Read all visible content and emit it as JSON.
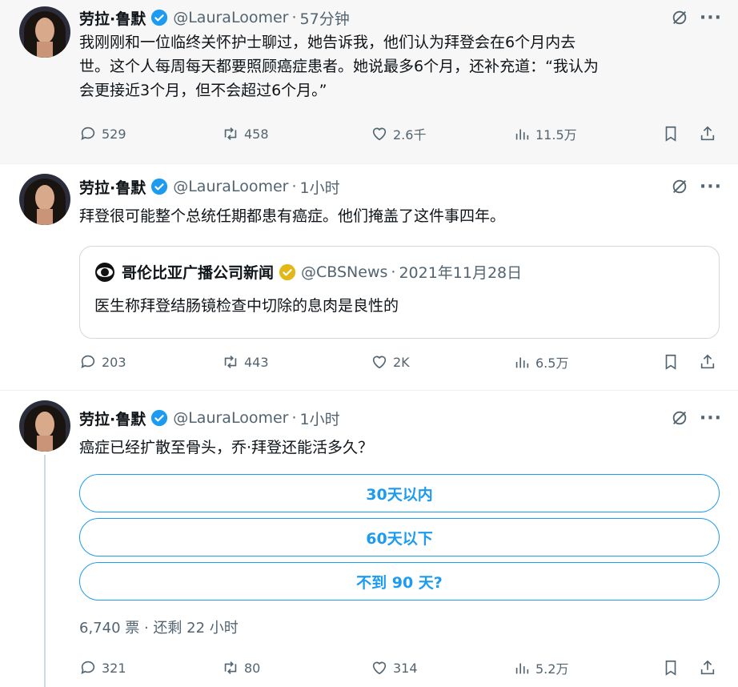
{
  "tweets": [
    {
      "author": "劳拉·鲁默",
      "handle": "@LauraLoomer",
      "sep": "·",
      "time": "57分钟",
      "text_lines": [
        "我刚刚和一位临终关怀护士聊过，她告诉我，他们认为拜登会在6个月内去",
        "世。这个人每周每天都要照顾癌症患者。她说最多6个月，还补充道：“我认为",
        "会更接近3个月，但不会超过6个月。”"
      ],
      "replies": "529",
      "retweets": "458",
      "likes": "2.6千",
      "views": "11.5万"
    },
    {
      "author": "劳拉·鲁默",
      "handle": "@LauraLoomer",
      "sep": "·",
      "time": "1小时",
      "text": "拜登很可能整个总统任期都患有癌症。他们掩盖了这件事四年。",
      "quote": {
        "author": "哥伦比亚广播公司新闻",
        "handle": "@CBSNews",
        "sep": "·",
        "date": "2021年11月28日",
        "text": "医生称拜登结肠镜检查中切除的息肉是良性的"
      },
      "replies": "203",
      "retweets": "443",
      "likes": "2K",
      "views": "6.5万"
    },
    {
      "author": "劳拉·鲁默",
      "handle": "@LauraLoomer",
      "sep": "·",
      "time": "1小时",
      "text": "癌症已经扩散至骨头，乔·拜登还能活多久？",
      "poll_options": [
        "30天以内",
        "60天以下",
        "不到 90 天?"
      ],
      "poll_meta": "6,740 票 · 还剩 22 小时",
      "replies": "321",
      "retweets": "80",
      "likes": "314",
      "views": "5.2万"
    }
  ],
  "icons": {
    "reply": "reply-icon",
    "retweet": "retweet-icon",
    "like": "heart-icon",
    "views": "views-icon",
    "bookmark": "bookmark-icon",
    "share": "share-icon",
    "grok": "grok-icon",
    "more": "more-icon",
    "verified": "verified-badge-icon"
  },
  "colors": {
    "accent": "#1d9bf0",
    "muted": "#536471",
    "gold": "#e2b719",
    "text": "#0f1419"
  }
}
